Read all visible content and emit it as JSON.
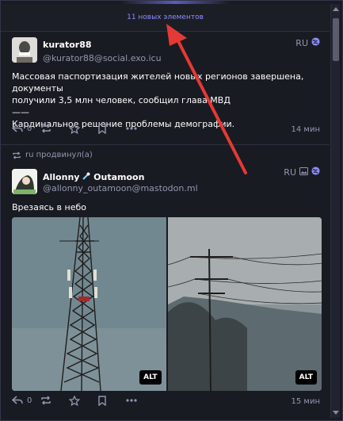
{
  "timeline": {
    "load_more_label": "11 новых элементов"
  },
  "statuses": [
    {
      "display_name": "kurator88",
      "handle": "@kurator88@social.exo.icu",
      "lang": "RU",
      "visibility_icon": "globe-icon",
      "avatar_text": "kurator88",
      "content_lines": [
        "Массовая паспортизация жителей новых регионов завершена, документы",
        "получили 3,5 млн человек, сообщил глава МВД",
        "——",
        "Кардинальное решение проблемы демографии."
      ],
      "reply_count": "0",
      "time": "14 мин"
    },
    {
      "boost_label": "ru продвинул(а)",
      "display_name": "Allonny",
      "display_name_suffix": "Outamoon",
      "handle": "@allonny_outamoon@mastodon.ml",
      "lang": "RU",
      "media_icon": "image-icon",
      "visibility_icon": "globe-icon",
      "content": "Врезаясь в небо",
      "media": [
        {
          "alt_label": "ALT"
        },
        {
          "alt_label": "ALT"
        }
      ],
      "reply_count": "0",
      "time": "15 мин"
    }
  ],
  "colors": {
    "background": "#191b22",
    "accent": "#8c8dff",
    "link": "#8c8dff",
    "annotation_arrow": "#e53935"
  }
}
